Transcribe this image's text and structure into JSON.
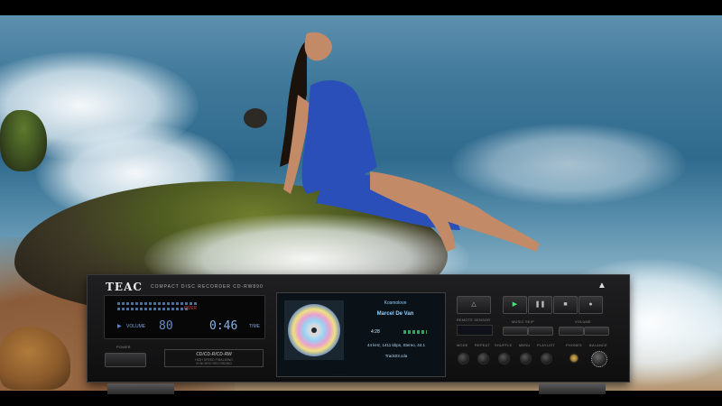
{
  "device": {
    "brand": "TEAC",
    "model_line": "COMPACT DISC RECORDER CD-RW890",
    "power_label": "POWER",
    "vfd": {
      "over_label": "OVER",
      "volume_label": "VOLUME",
      "volume_value": "80",
      "time_label": "TIME",
      "time_value": "0:46"
    },
    "tray": {
      "line1": "CD/CD-R/CD-RW",
      "line2": "HIGH SPEED FINALIZING",
      "line3": "SYNCHRO RECORDING"
    },
    "now_playing": {
      "title": "Kosmolove",
      "artist": "Marcel De Van",
      "elapsed": "4:28",
      "format_info": "44 kHz, 1411 kbps, Stereo, 44.1",
      "file": "Track03.cda"
    },
    "labels": {
      "remote_sensor": "REMOTE SENSOR",
      "music_skip": "MUSIC SKIP",
      "volume": "VOLUME",
      "mode": "MODE",
      "repeat": "REPEAT",
      "shuffle": "SHUFFLE",
      "menu": "MENU",
      "playlist": "PLAYLIST",
      "phones": "PHONES",
      "balance": "BALANCE"
    },
    "transport": {
      "eject": "△",
      "play": "▶",
      "pause": "❚❚",
      "stop": "■",
      "record": "●"
    }
  },
  "colors": {
    "vfd_blue": "#8ab0e8",
    "screen_text": "#8fd0ff",
    "dress": "#2a4fb8",
    "overload": "#d83a3a"
  }
}
